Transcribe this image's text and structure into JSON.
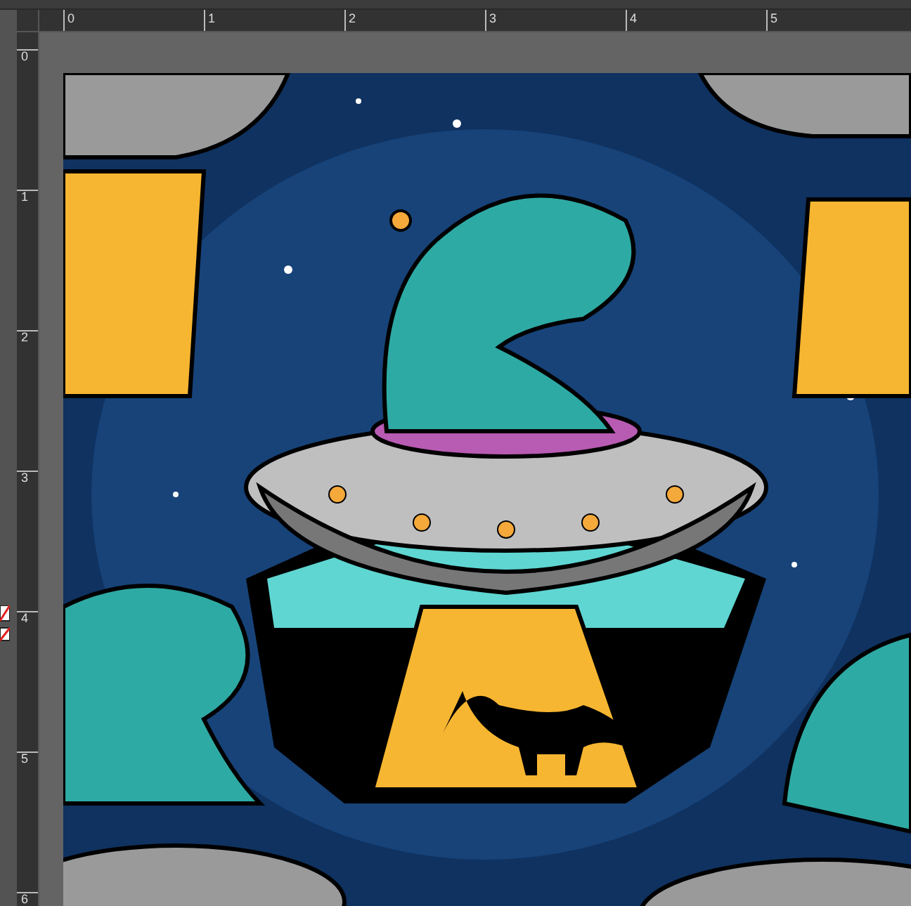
{
  "horizontal_ruler": {
    "labels": [
      "0",
      "1",
      "2",
      "3",
      "4",
      "5"
    ]
  },
  "vertical_ruler": {
    "labels": [
      "0",
      "1",
      "2",
      "3",
      "4",
      "5",
      "6"
    ]
  }
}
